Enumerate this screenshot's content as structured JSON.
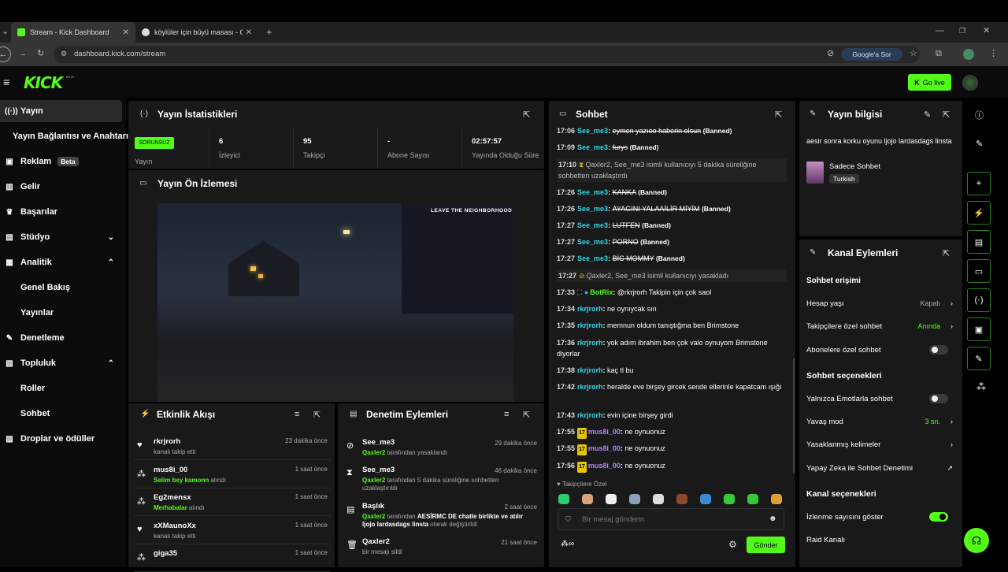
{
  "browser": {
    "tabs": [
      {
        "label": "Stream - Kick Dashboard"
      },
      {
        "label": "köylüler için büyü masası - Goo"
      }
    ],
    "url": "dashboard.kick.com/stream",
    "ask_google": "Google'a Sor"
  },
  "header": {
    "logo": "KICK",
    "beta": "BETA",
    "go_live": "Go live"
  },
  "sidebar": {
    "items": [
      {
        "label": "Yayın",
        "icon": "broadcast-icon"
      },
      {
        "label": "Yayın Bağlantısı ve Anahtarı"
      },
      {
        "label": "Reklam",
        "badge": "Beta",
        "icon": "ad-icon"
      },
      {
        "label": "Gelir",
        "icon": "revenue-icon"
      },
      {
        "label": "Başarılar",
        "icon": "trophy-icon"
      },
      {
        "label": "Stüdyo",
        "icon": "studio-icon"
      },
      {
        "label": "Analitik",
        "icon": "analytics-icon"
      },
      {
        "label": "Genel Bakış"
      },
      {
        "label": "Yayınlar"
      },
      {
        "label": "Denetleme",
        "icon": "wrench-icon"
      },
      {
        "label": "Topluluk",
        "icon": "community-icon"
      },
      {
        "label": "Roller"
      },
      {
        "label": "Sohbet"
      },
      {
        "label": "Droplar ve ödüller",
        "icon": "drops-icon"
      }
    ]
  },
  "stats": {
    "title": "Yayın İstatistikleri",
    "status": "SORUNSUZ",
    "cells": [
      {
        "label": "Yayın",
        "value": ""
      },
      {
        "label": "İzleyici",
        "value": "6"
      },
      {
        "label": "Takipçi",
        "value": "95"
      },
      {
        "label": "Abone Sayısı",
        "value": "-"
      },
      {
        "label": "Yayında Olduğu Süre",
        "value": "02:57:57"
      }
    ]
  },
  "preview": {
    "title": "Yayın Ön İzlemesi",
    "overlay": "LEAVE THE NEIGHBORHOOD"
  },
  "activity": {
    "title": "Etkinlik Akışı",
    "rows": [
      {
        "name": "rkrjrorh",
        "sub": "kanalı takip etti",
        "hl": "",
        "time": "23 dakika önce",
        "icon": "heart-icon"
      },
      {
        "name": "mus8i_00",
        "hl": "Selim bey kamonn",
        "sub": " alındı",
        "time": "1 saat önce",
        "icon": "points-icon"
      },
      {
        "name": "Eg2mensx",
        "hl": "Merhabalar",
        "sub": " alındı",
        "time": "1 saat önce",
        "icon": "points-icon"
      },
      {
        "name": "xXMaunoXx",
        "sub": "kanalı takip etti",
        "hl": "",
        "time": "1 saat önce",
        "icon": "heart-icon"
      },
      {
        "name": "giga35",
        "sub": "",
        "hl": "",
        "time": "1 saat önce",
        "icon": "points-icon"
      }
    ]
  },
  "moderation": {
    "title": "Denetim Eylemleri",
    "rows": [
      {
        "name": "See_me3",
        "actor": "Qaxler2",
        "text": " tarafından yasaklandı",
        "time": "29 dakika önce",
        "icon": "ban-icon"
      },
      {
        "name": "See_me3",
        "actor": "Qaxler2",
        "text": " tarafından 5 dakika süreliğine sohbetten uzaklaştırıldı",
        "time": "46 dakika önce",
        "icon": "hourglass-icon"
      },
      {
        "name": "Başlık",
        "actor": "Qaxler2",
        "text": " tarafından ",
        "bold": "AESİRMC DE chatle birlikte ve atılır ljojo lardasdags linsta",
        "text2": " olarak değiştirildi",
        "time": "2 saat önce",
        "icon": "title-icon"
      },
      {
        "name": "Qaxler2",
        "actor": "",
        "text": "bir mesajı sildi",
        "time": "21 saat önce",
        "icon": "trash-icon"
      }
    ]
  },
  "chat": {
    "title": "Sohbet",
    "lines": [
      {
        "time": "17:06",
        "user": "See_me3",
        "msg": "eymen yazıoo haberin olsun",
        "banned": "(Banned)"
      },
      {
        "time": "17:09",
        "user": "See_me3",
        "msg": "furys",
        "banned": "(Banned)"
      },
      {
        "time": "17:10",
        "sys": "Qaxler2, See_me3 isimli kullanıcıyı 5 dakika süreliğine sohbetten uzaklaştırdı"
      },
      {
        "time": "17:26",
        "user": "See_me3",
        "msg": "KANKA",
        "banned": "(Banned)"
      },
      {
        "time": "17:26",
        "user": "See_me3",
        "msg": "AYAGINI YALAAİLİR MİYİM",
        "banned": "(Banned)"
      },
      {
        "time": "17:27",
        "user": "See_me3",
        "msg": "LUTFEN",
        "banned": "(Banned)"
      },
      {
        "time": "17:27",
        "user": "See_me3",
        "msg": "PORNO",
        "banned": "(Banned)"
      },
      {
        "time": "17:27",
        "user": "See_me3",
        "msg": "BİC MOMMY",
        "banned": "(Banned)"
      },
      {
        "time": "17:27",
        "sys": "Qaxler2, See_me3 isimli kullanıcıyı yasakladı"
      },
      {
        "time": "17:33",
        "user": "BotRix",
        "msg": "@rkrjrorh Takipin için çok saol"
      },
      {
        "time": "17:34",
        "user": "rkrjrorh",
        "msg": "ne oynıycak sın"
      },
      {
        "time": "17:35",
        "user": "rkrjrorh",
        "msg": "memnun oldum tanıştığma ben Brimstone"
      },
      {
        "time": "17:36",
        "user": "rkrjrorh",
        "msg": "yok adım ibrahim ben çok valo oynuyom Brimstone diyorlar"
      },
      {
        "time": "17:38",
        "user": "rkrjrorh",
        "msg": "kaç tl bu"
      },
      {
        "time": "17:42",
        "user": "rkrjrorh",
        "msg": "heralde eve birşey gircek sende ellerinle kapatcam ışığı"
      },
      {
        "time": "17:43",
        "user": "rkrjrorh",
        "msg": "evin içine birşey girdi"
      },
      {
        "time": "17:55",
        "user": "mus8i_00",
        "msg": "ne oynuonuz",
        "badge": "17"
      },
      {
        "time": "17:55",
        "user": "mus8i_00",
        "msg": "ne oynuonuz",
        "badge": "17"
      },
      {
        "time": "17:56",
        "user": "mus8i_00",
        "msg": "ne oynuonuz",
        "badge": "17"
      }
    ],
    "followers_only": "Takipçilere Özel",
    "placeholder": "Bir mesaj gönderin",
    "send": "Gönder"
  },
  "info": {
    "title": "Yayın bilgisi",
    "stream_title": "aesir sonra korku oyunu ljojo lardasdags linsta",
    "category": "Sadece Sohbet",
    "language": "Turkish"
  },
  "channel": {
    "title": "Kanal Eylemleri",
    "chat_access": "Sohbet erişimi",
    "account_age": "Hesap yaşı",
    "account_age_val": "Kapalı",
    "followers_chat": "Takipçilere özel sohbet",
    "followers_chat_val": "Anında",
    "subs_chat": "Abonelere özel sohbet",
    "chat_options": "Sohbet seçenekleri",
    "emote_only": "Yalnızca Emotlarla sohbet",
    "slow_mode": "Yavaş mod",
    "slow_mode_val": "3 sn.",
    "banned_words": "Yasaklanmış kelimeler",
    "ai_mod": "Yapay Zeka ile Sohbet Denetimi",
    "channel_options": "Kanal seçenekleri",
    "show_viewers": "İzlenme sayısını göster",
    "raid": "Raid Kanalı"
  },
  "colors": {
    "accent": "#53fc18",
    "panel": "#191919",
    "bg": "#0b0b0b",
    "chat_user": "#33d6e6"
  }
}
